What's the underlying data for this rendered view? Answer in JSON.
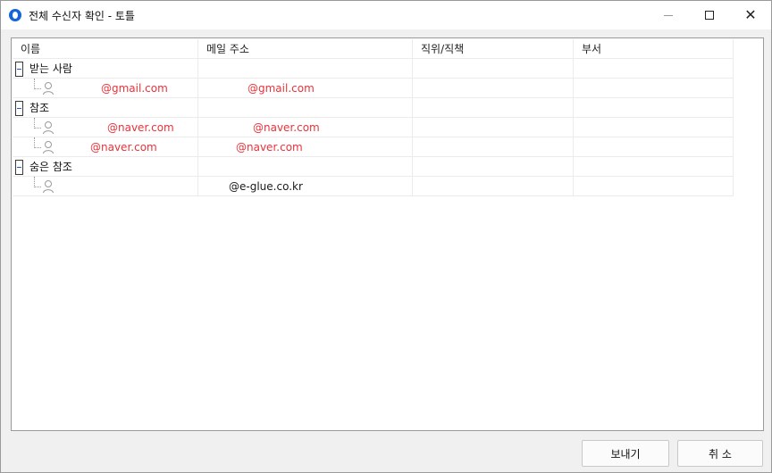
{
  "window": {
    "title": "전체 수신자 확인 - 토틀",
    "accent_color": "#1565d8",
    "controls": {
      "minimize": "—",
      "maximize": "",
      "close": "✕"
    }
  },
  "table": {
    "columns": [
      "이름",
      "메일 주소",
      "직위/직책",
      "부서"
    ],
    "groups": [
      {
        "label": "받는 사람",
        "recipients": [
          {
            "name": "@gmail.com",
            "email": "@gmail.com",
            "title": "",
            "dept": ""
          }
        ]
      },
      {
        "label": "참조",
        "recipients": [
          {
            "name": "@naver.com",
            "email": "@naver.com",
            "title": "",
            "dept": ""
          },
          {
            "name": "@naver.com",
            "email": "@naver.com",
            "title": "",
            "dept": ""
          }
        ]
      },
      {
        "label": "숨은 참조",
        "recipients": [
          {
            "name": "",
            "email": "@e-glue.co.kr",
            "title": "",
            "dept": ""
          }
        ]
      }
    ],
    "highlight_color": "#e8333b"
  },
  "buttons": {
    "send": "보내기",
    "cancel": "취 소"
  }
}
